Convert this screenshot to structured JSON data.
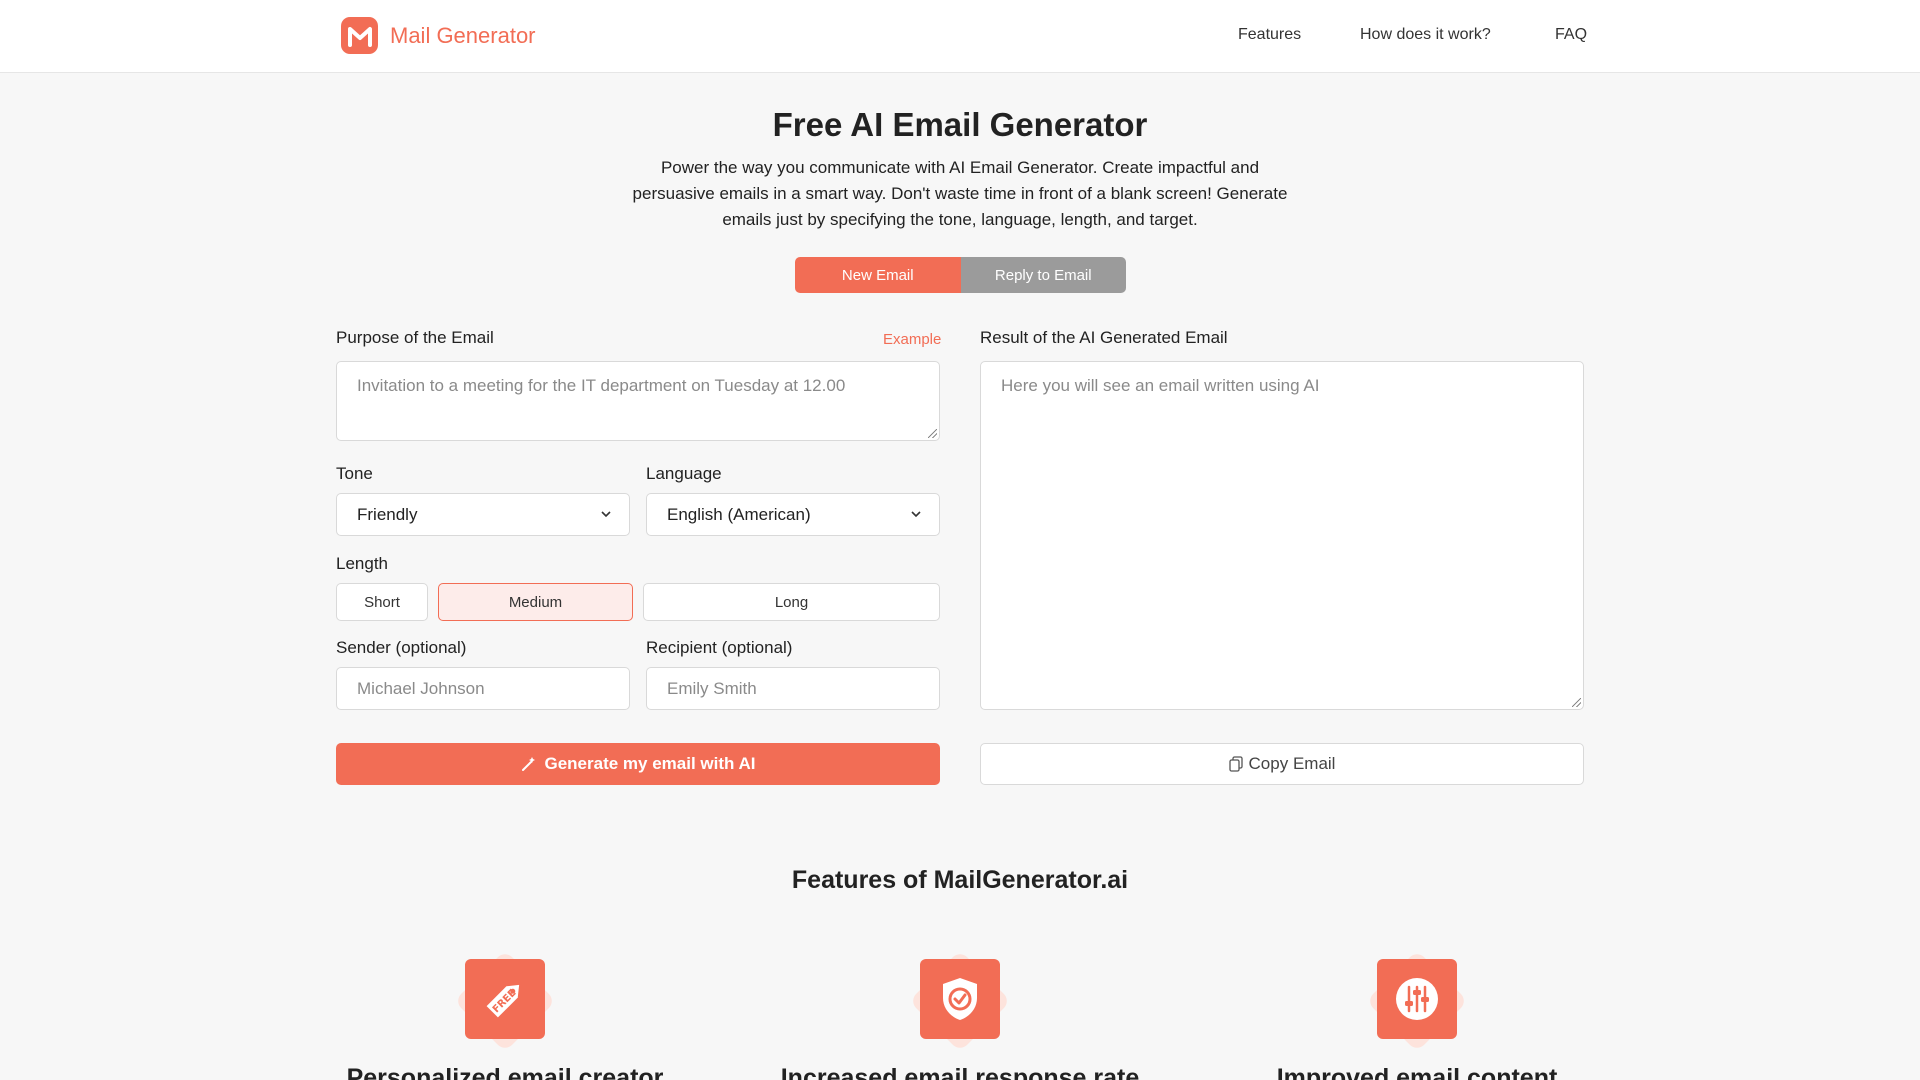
{
  "header": {
    "brand": "Mail Generator",
    "nav": [
      "Features",
      "How does it work?",
      "FAQ"
    ]
  },
  "hero": {
    "title": "Free AI Email Generator",
    "description": "Power the way you communicate with AI Email Generator. Create impactful and persuasive emails in a smart way. Don't waste time in front of a blank screen! Generate emails just by specifying the tone, language, length, and target."
  },
  "mode_tabs": {
    "new_email": "New Email",
    "reply_email": "Reply to Email",
    "active": "New Email"
  },
  "form": {
    "purpose_label": "Purpose of the Email",
    "example_link": "Example",
    "purpose_placeholder": "Invitation to a meeting for the IT department on Tuesday at 12.00",
    "tone_label": "Tone",
    "tone_value": "Friendly",
    "language_label": "Language",
    "language_value": "English (American)",
    "length_label": "Length",
    "length_options": [
      "Short",
      "Medium",
      "Long"
    ],
    "length_selected": "Medium",
    "sender_label": "Sender (optional)",
    "sender_placeholder": "Michael Johnson",
    "recipient_label": "Recipient (optional)",
    "recipient_placeholder": "Emily Smith",
    "generate_button": "Generate my email with AI"
  },
  "result": {
    "label": "Result of the AI Generated Email",
    "placeholder": "Here you will see an email written using AI",
    "copy_button": "Copy Email"
  },
  "features": {
    "title": "Features of MailGenerator.ai",
    "items": [
      {
        "title": "Personalized email creator",
        "icon": "free-tag-icon"
      },
      {
        "title": "Increased email response rate",
        "icon": "shield-check-icon"
      },
      {
        "title": "Improved email content",
        "icon": "sliders-icon"
      }
    ]
  },
  "colors": {
    "accent": "#f26d55",
    "accent_light": "#fdecea",
    "inactive_tab": "#9b9b9b",
    "background": "#f7f7f7"
  }
}
